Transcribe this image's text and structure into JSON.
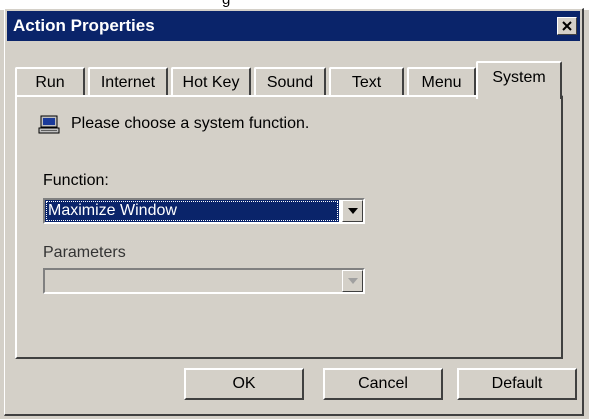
{
  "background_strip_text": "g",
  "window": {
    "title": "Action Properties",
    "close_label": "×"
  },
  "tabs": [
    {
      "label": "Run",
      "active": false
    },
    {
      "label": "Internet",
      "active": false
    },
    {
      "label": "Hot Key",
      "active": false
    },
    {
      "label": "Sound",
      "active": false
    },
    {
      "label": "Text",
      "active": false
    },
    {
      "label": "Menu",
      "active": false
    },
    {
      "label": "System",
      "active": true
    }
  ],
  "panel": {
    "icon": "computer-icon",
    "prompt": "Please choose a system function.",
    "function_label": "Function:",
    "function_value": "Maximize Window",
    "parameters_label": "Parameters",
    "parameters_value": "",
    "parameters_enabled": false
  },
  "buttons": {
    "ok": "OK",
    "cancel": "Cancel",
    "default": "Default"
  },
  "colors": {
    "titlebar": "#0a246a",
    "face": "#d4d0c8",
    "selection": "#0a246a"
  }
}
